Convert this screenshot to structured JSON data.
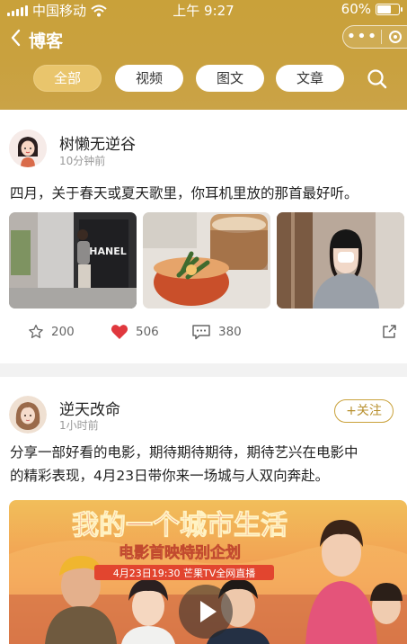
{
  "status_bar": {
    "carrier": "中国移动",
    "time": "上午 9:27",
    "battery": "60%"
  },
  "nav": {
    "title": "博客"
  },
  "tabs": [
    {
      "label": "全部",
      "active": true
    },
    {
      "label": "视频",
      "active": false
    },
    {
      "label": "图文",
      "active": false
    },
    {
      "label": "文章",
      "active": false
    }
  ],
  "colors": {
    "header": "#c9a13a",
    "active_tab": "#e9c56c",
    "like": "#e0383e",
    "follow": "#c9a13a"
  },
  "posts": [
    {
      "author": "树懒无逆谷",
      "time": "10分钟前",
      "text": "四月，关于春天或夏天歌里，你耳机里放的那首最好听。",
      "images": [
        "street-photo",
        "coffee-photo",
        "selfie-photo"
      ],
      "image_sign": "CHANEL",
      "stars": "200",
      "likes": "506",
      "comments": "380"
    },
    {
      "author": "逆天改命",
      "time": "1小时前",
      "follow_label": "+关注",
      "text_line1": "分享一部好看的电影，期待期待期待，期待艺兴在电影中",
      "text_line2": "的精彩表现，4月23日带你来一场城与人双向奔赴。",
      "poster": {
        "title": "我的一个城市生活",
        "subtitle": "电影首映特别企划",
        "date_line": "4月23日19:30 芒果TV全网直播"
      }
    }
  ]
}
